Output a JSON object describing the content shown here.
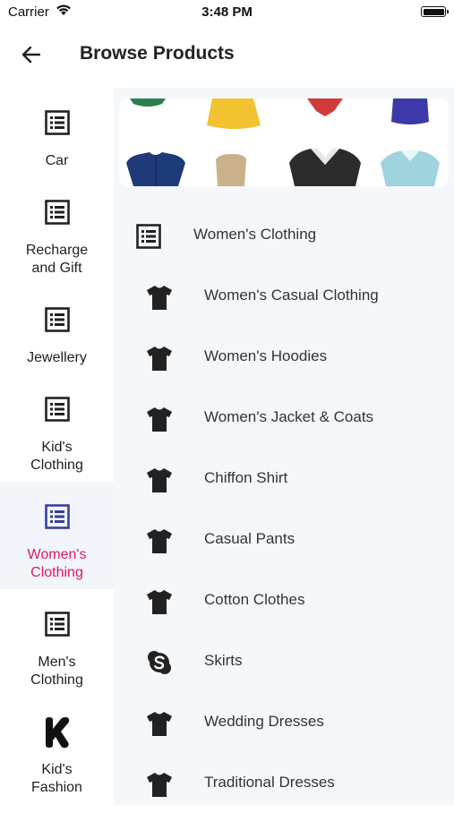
{
  "status_bar": {
    "carrier": "Carrier",
    "time": "3:48 PM"
  },
  "header": {
    "title": "Browse Products",
    "back_icon": "arrow-left-icon"
  },
  "sidebar": {
    "active_color": "#d8186a",
    "items": [
      {
        "label": "Car",
        "icon": "list-icon"
      },
      {
        "label": "Recharge and Gift",
        "icon": "list-icon"
      },
      {
        "label": "Jewellery",
        "icon": "list-icon"
      },
      {
        "label": "Kid's Clothing",
        "icon": "list-icon"
      },
      {
        "label": "Women's Clothing",
        "icon": "list-icon",
        "active": true
      },
      {
        "label": "Men's Clothing",
        "icon": "list-icon"
      },
      {
        "label": "Kid's Fashion",
        "icon": "k-logo-icon"
      }
    ]
  },
  "content": {
    "banner": "clothing-banner-image",
    "category_header": {
      "label": "Women's Clothing",
      "icon": "list-icon"
    },
    "subcategories": [
      {
        "label": "Women's Casual Clothing",
        "icon": "tshirt-icon"
      },
      {
        "label": "Women's Hoodies",
        "icon": "tshirt-icon"
      },
      {
        "label": "Women's Jacket & Coats",
        "icon": "tshirt-icon"
      },
      {
        "label": "Chiffon Shirt",
        "icon": "tshirt-icon"
      },
      {
        "label": "Casual Pants",
        "icon": "tshirt-icon"
      },
      {
        "label": "Cotton Clothes",
        "icon": "tshirt-icon"
      },
      {
        "label": "Skirts",
        "icon": "skype-icon"
      },
      {
        "label": "Wedding Dresses",
        "icon": "tshirt-icon"
      },
      {
        "label": "Traditional Dresses",
        "icon": "tshirt-icon"
      }
    ]
  }
}
